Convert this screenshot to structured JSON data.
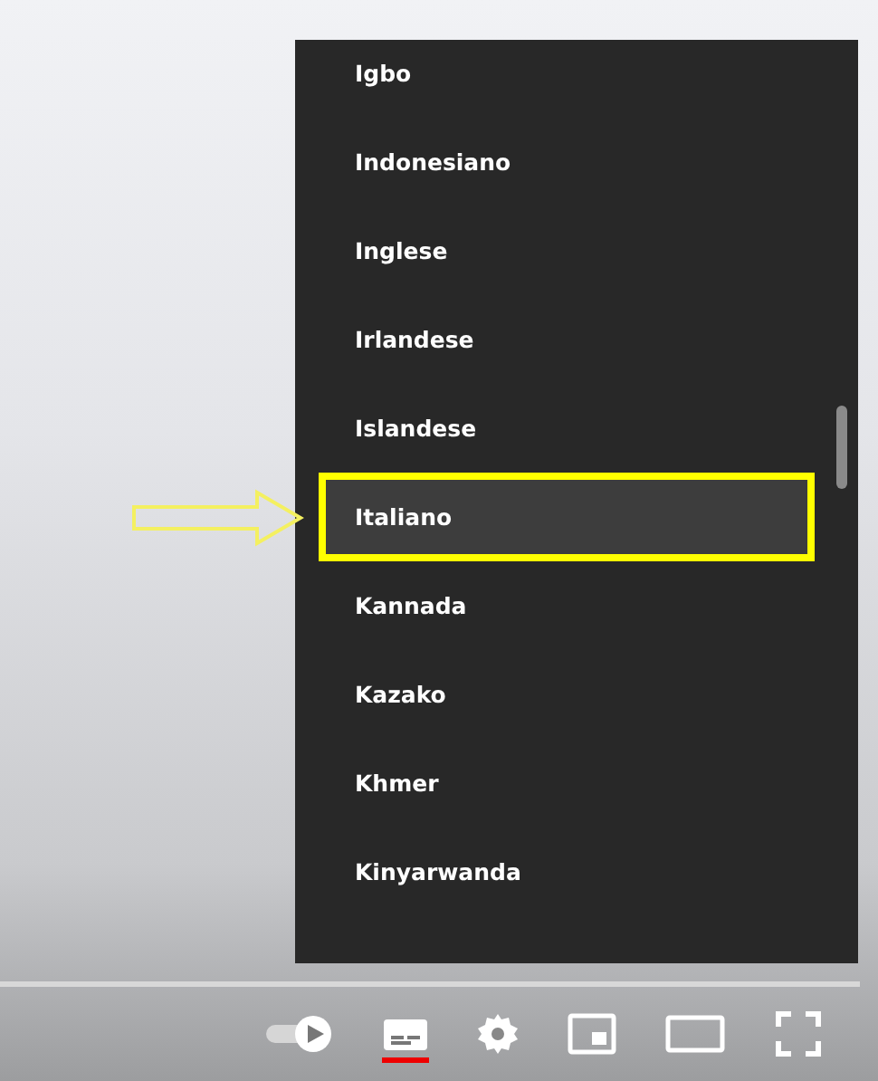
{
  "menu": {
    "items": [
      {
        "label": "Igbo",
        "selected": false,
        "outlined": false
      },
      {
        "label": "Indonesiano",
        "selected": false,
        "outlined": false
      },
      {
        "label": "Inglese",
        "selected": false,
        "outlined": false
      },
      {
        "label": "Irlandese",
        "selected": false,
        "outlined": false
      },
      {
        "label": "Islandese",
        "selected": false,
        "outlined": false
      },
      {
        "label": "Italiano",
        "selected": true,
        "outlined": true
      },
      {
        "label": "Kannada",
        "selected": false,
        "outlined": false
      },
      {
        "label": "Kazako",
        "selected": false,
        "outlined": false
      },
      {
        "label": "Khmer",
        "selected": false,
        "outlined": false
      },
      {
        "label": "Kinyarwanda",
        "selected": false,
        "outlined": false
      }
    ]
  },
  "controls": {
    "autoplay_on": true,
    "subtitles_on": true
  }
}
